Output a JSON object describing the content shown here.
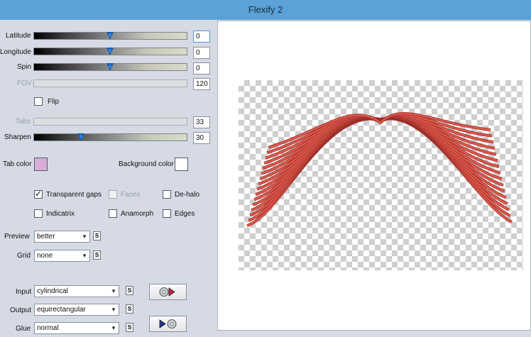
{
  "window": {
    "title": "Flexify 2"
  },
  "sliders": {
    "latitude": {
      "label": "Latitude",
      "value": "0",
      "position": 0.5,
      "enabled": true
    },
    "longitude": {
      "label": "Longitude",
      "value": "0",
      "position": 0.5,
      "enabled": true
    },
    "spin": {
      "label": "Spin",
      "value": "0",
      "position": 0.5,
      "enabled": true
    },
    "fov": {
      "label": "FOV",
      "value": "120",
      "enabled": false
    },
    "tabs": {
      "label": "Tabs",
      "value": "33",
      "enabled": false
    },
    "sharpen": {
      "label": "Sharpen",
      "value": "30",
      "position": 0.3,
      "enabled": true
    }
  },
  "flip": {
    "label": "Flip",
    "checked": false
  },
  "colors": {
    "tab_color": {
      "label": "Tab color",
      "value": "#d7aed9"
    },
    "background_color": {
      "label": "Background color",
      "value": "#ffffff"
    },
    "slider_thumb": "#1a5ba8",
    "title_bar": "#5aa2d8",
    "strands": "#e0584c"
  },
  "options": {
    "transparent_gaps": {
      "label": "Transparent gaps",
      "checked": true
    },
    "faces": {
      "label": "Faces",
      "checked": false,
      "enabled": false
    },
    "de_halo": {
      "label": "De-halo",
      "checked": false
    },
    "indicatrix": {
      "label": "Indicatrix",
      "checked": false
    },
    "anamorph": {
      "label": "Anamorph",
      "checked": false
    },
    "edges": {
      "label": "Edges",
      "checked": false
    }
  },
  "preview": {
    "label": "Preview",
    "value": "better"
  },
  "grid": {
    "label": "Grid",
    "value": "none"
  },
  "input": {
    "label": "Input",
    "value": "cylindrical"
  },
  "output": {
    "label": "Output",
    "value": "equirectangular"
  },
  "glue": {
    "label": "Glue",
    "value": "normal"
  },
  "s_button_label": "S",
  "icons": {
    "dropdown": "chevron-down-icon",
    "input_button": "disc-play-icon",
    "output_button": "play-disc-icon"
  }
}
